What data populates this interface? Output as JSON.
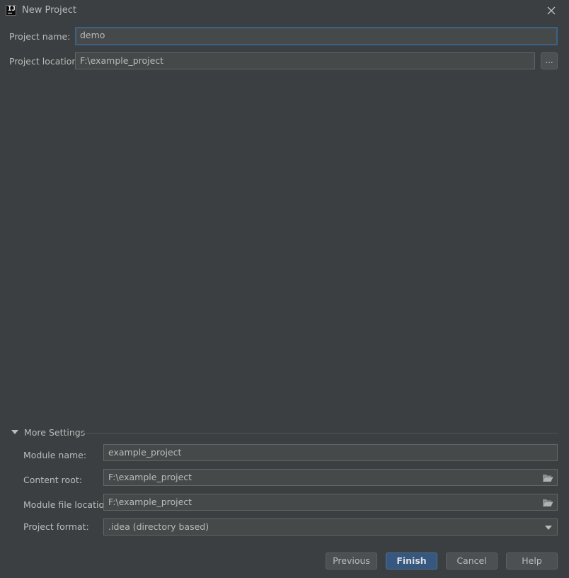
{
  "window": {
    "title": "New Project"
  },
  "form": {
    "project_name_label": "Project name:",
    "project_name_value": "demo",
    "project_location_label": "Project location:",
    "project_location_value": "F:\\example_project",
    "browse_label": "..."
  },
  "more_settings": {
    "title": "More Settings",
    "module_name_label": "Module name:",
    "module_name_value": "example_project",
    "content_root_label": "Content root:",
    "content_root_value": "F:\\example_project",
    "module_file_location_label": "Module file location:",
    "module_file_location_value": "F:\\example_project",
    "project_format_label": "Project format:",
    "project_format_value": ".idea (directory based)"
  },
  "buttons": {
    "previous": "Previous",
    "finish": "Finish",
    "cancel": "Cancel",
    "help": "Help"
  },
  "colors": {
    "background": "#3c3f41",
    "field_background": "#45494a",
    "focus_border": "#3d6185",
    "primary_button": "#365880",
    "text": "#bbbbbb"
  },
  "icons": {
    "app": "intellij-idea-icon",
    "close": "close-icon",
    "browse": "folder-open-icon",
    "collapse": "triangle-down-icon",
    "dropdown": "chevron-down-icon"
  }
}
